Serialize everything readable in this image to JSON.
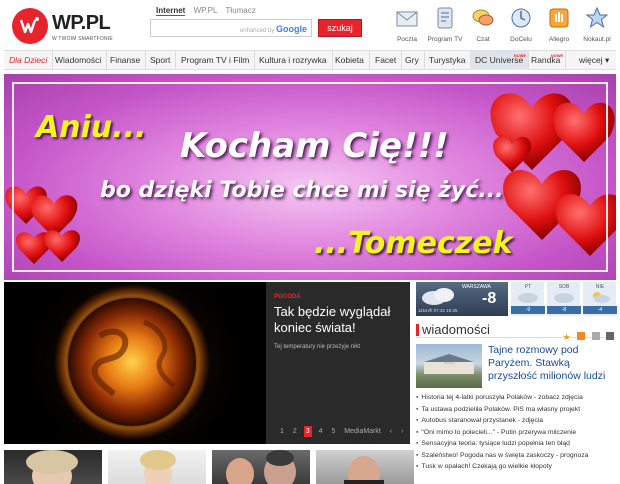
{
  "logo": {
    "text": "WP.PL",
    "tagline": "W TWOIM SMARTFONIE"
  },
  "search": {
    "tabs": [
      "Internet",
      "WP.PL",
      "Tłumacz"
    ],
    "powered_by": "enhanced by",
    "powered_brand": "Google",
    "button_label": "szukaj"
  },
  "services": [
    {
      "label": "Poczta",
      "icon": "mail-icon"
    },
    {
      "label": "Program TV",
      "icon": "tv-program-icon"
    },
    {
      "label": "Czat",
      "icon": "chat-icon"
    },
    {
      "label": "DoCelu",
      "icon": "docelu-icon"
    },
    {
      "label": "Allegro",
      "icon": "allegro-icon"
    },
    {
      "label": "Nokaut.pl",
      "icon": "nokaut-icon"
    }
  ],
  "nav": {
    "items": [
      "Dla Dzieci",
      "Wiadomości",
      "Finanse",
      "Sport",
      "Program TV i Film",
      "Kultura i rozrywka",
      "Kobieta",
      "Facet",
      "Gry",
      "Turystyka",
      "DC Universe",
      "Randka"
    ],
    "new_badge": "NOWE",
    "more": "więcej"
  },
  "banner": {
    "line1": "Aniu...",
    "line2": "Kocham Cię!!!",
    "line3": "bo dzięki Tobie chce mi się żyć...",
    "line4": "...Tomeczek"
  },
  "feature": {
    "category": "POGODA",
    "title": "Tak będzie wyglądał koniec świata!",
    "subtitle": "Tej temperatury nie przeżyje nikt",
    "pages": [
      "1",
      "2",
      "3",
      "4",
      "5"
    ],
    "current_page": "3",
    "sponsor": "MediaMarkt"
  },
  "weather": {
    "city": "WARSZAWA",
    "temp": "-8",
    "details": "11km/h  07:42  15:25",
    "days": [
      {
        "day": "PT",
        "temp": "-9"
      },
      {
        "day": "SOB",
        "temp": "-8"
      },
      {
        "day": "NIE",
        "temp": "-4"
      }
    ]
  },
  "news": {
    "title": "wiadomości",
    "top_headline": "Tajne rozmowy pod Paryżem. Stawką przyszłość milionów ludzi",
    "items": [
      "Historia tej 4-latki poruszyła Polaków - zobacz zdjęcia",
      "Ta ustawa podzieliła Polaków. PiS ma własny projekt",
      "Autobus staranował przystanek - zdjęcia",
      "\"Oni mimo to polecieli...\" - Putin przerywa milczenie",
      "Sensacyjna teoria: tysiące ludzi popełnia ten błąd",
      "Szaleństwo! Pogoda nas w święta zaskoczy - prognoza",
      "Tusk w opałach! Czekają go wielkie kłopoty"
    ]
  },
  "colors": {
    "brand": "#e8232b",
    "link": "#1a4a9a",
    "banner_bg": "#c455c8",
    "banner_yellow": "#f2f51e"
  }
}
